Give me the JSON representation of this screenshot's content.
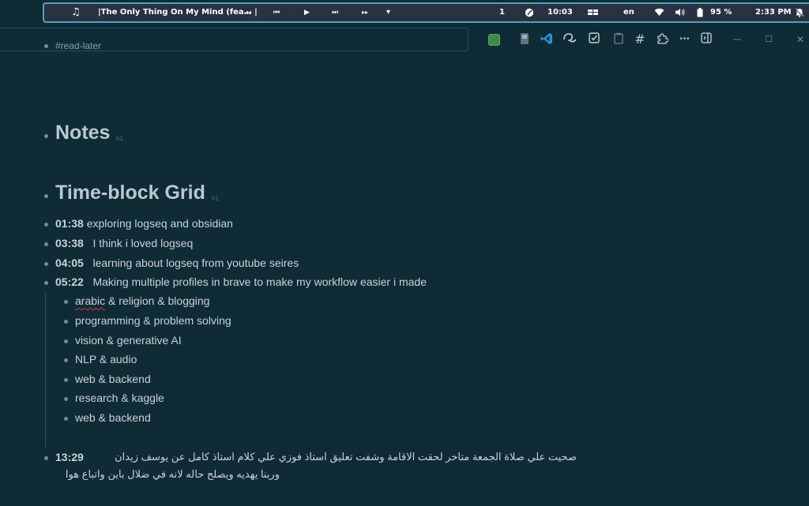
{
  "system_bar": {
    "music_icon": "♫",
    "track_title": "|The Only Thing On My Mind (fea… |",
    "controls": {
      "rewind": "◂◂",
      "previous": "⏮",
      "play": "▶",
      "next": "⏭",
      "forward": "▸▸",
      "menu": "▾"
    },
    "workspace": "1",
    "timer": "10:03",
    "language": "en",
    "battery": "95 %",
    "clock": "2:33 PM"
  },
  "search": {
    "query_fragment": "#read-later"
  },
  "toolbar": {
    "icons": [
      "green-square",
      "puzzle-app-icon",
      "vscode-icon",
      "whiteboard-icon",
      "checkbox-icon",
      "clipboard-icon",
      "hash-icon",
      "plugin-icon",
      "more-icon",
      "sidebar-toggle-icon"
    ],
    "more_glyph": "•••",
    "hash_glyph": "#"
  },
  "window_controls": {
    "minimize": "—",
    "maximize": "☐",
    "close": "✕"
  },
  "content": {
    "top_item": "#read-later",
    "headings": [
      {
        "text": "Notes",
        "tag": "h1"
      },
      {
        "text": "Time-block Grid",
        "tag": "h1"
      }
    ],
    "timeblocks": [
      {
        "time": "01:38",
        "text": "exploring logseq and obsidian"
      },
      {
        "time": "03:38",
        "text": "I think i loved logseq"
      },
      {
        "time": "04:05",
        "text": "learning about logseq from youtube seires"
      },
      {
        "time": "05:22",
        "text": "Making multiple profiles in brave to make my workflow easier i made"
      }
    ],
    "profiles": [
      {
        "first": "arabic",
        "rest": " & religion & blogging"
      },
      {
        "first": "",
        "rest": "programming & problem solving"
      },
      {
        "first": "",
        "rest": "vision & generative AI"
      },
      {
        "first": "",
        "rest": "NLP & audio"
      },
      {
        "first": "",
        "rest": "web & backend"
      },
      {
        "first": "",
        "rest": "research & kaggle"
      },
      {
        "first": "",
        "rest": "web & backend"
      }
    ],
    "last_block": {
      "time": "13:29",
      "line1": "صحيت علي صلاة الجمعة متاخر لحقت الاقامة وشفت تعليق استاذ فوزي علي كلام استاذ كامل عن يوسف زيدان",
      "line2": "وربنا يهديه ويصلح حاله لانه في ضلال باين واتباع هوا"
    }
  }
}
